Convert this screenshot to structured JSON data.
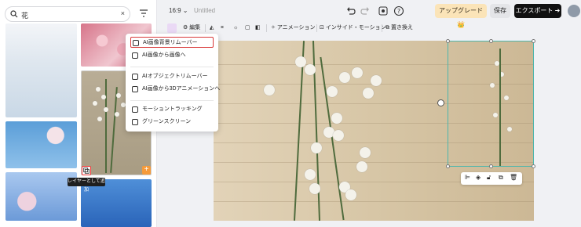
{
  "search": {
    "value": "花"
  },
  "left_panel": {
    "tooltip": "レイヤーとして追加",
    "add_glyph": "+"
  },
  "topbar": {
    "ratio": "16:9 ⌄",
    "title": "Untitled",
    "upgrade": "アップグレード 👑",
    "save": "保存",
    "export": "エクスポート ➜"
  },
  "toolbar": {
    "edit": "編集",
    "animation": "アニメーション",
    "inside_motion": "インサイド・モーション",
    "replace": "置き換え"
  },
  "menu": {
    "items": [
      {
        "label": "AI画像背景リムーバー",
        "icon": "bg-remove-icon",
        "highlighted": true
      },
      {
        "label": "AI画像から画像へ",
        "icon": "image-to-image-icon"
      },
      {
        "label": "AIオブジェクトリムーバー",
        "icon": "object-remove-icon"
      },
      {
        "label": "AI画像から3Dアニメーションへ",
        "icon": "3d-animation-icon"
      },
      {
        "label": "モーショントラッキング",
        "icon": "motion-tracking-icon"
      },
      {
        "label": "グリーンスクリーン",
        "icon": "green-screen-icon"
      }
    ]
  },
  "colors": {
    "accent_selection": "#4db6ac",
    "highlight_border": "#d93a3a",
    "export_bg": "#111111",
    "upgrade_bg": "#fbe4b8"
  }
}
